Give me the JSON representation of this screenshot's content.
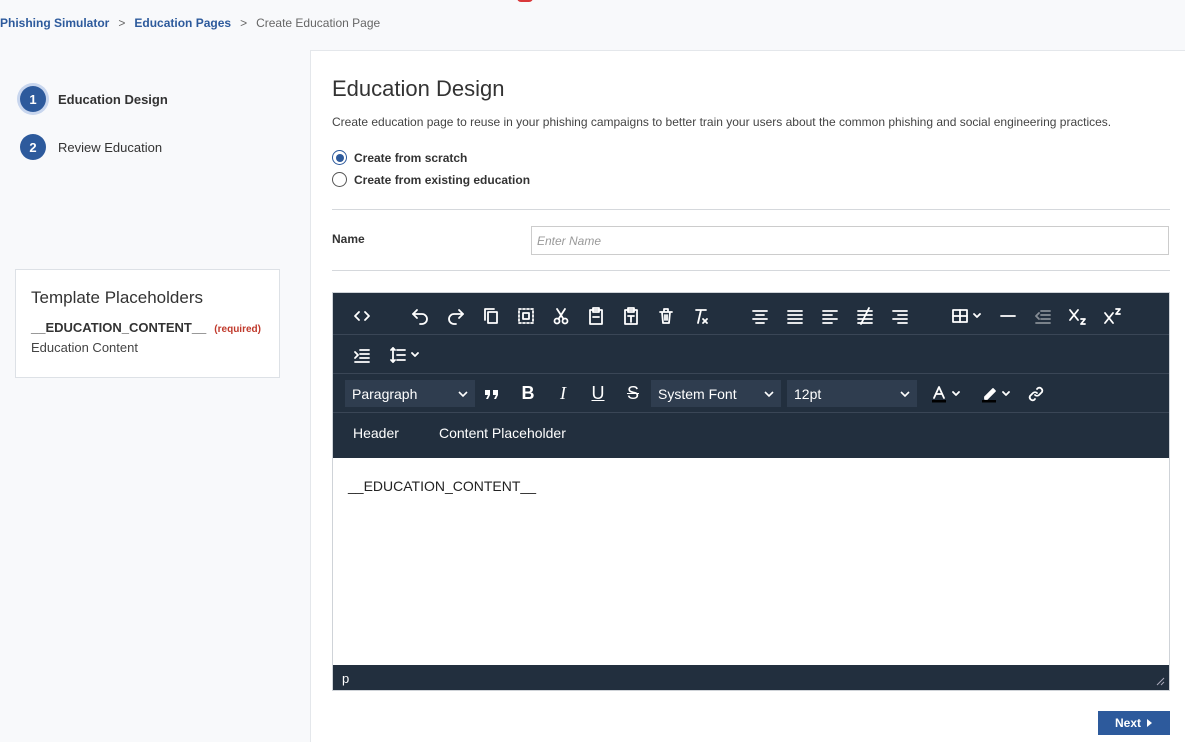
{
  "breadcrumb": {
    "item1": "Phishing Simulator",
    "item2": "Education Pages",
    "current": "Create Education Page",
    "separator": ">"
  },
  "steps": [
    {
      "number": "1",
      "label": "Education Design",
      "active": true
    },
    {
      "number": "2",
      "label": "Review Education",
      "active": false
    }
  ],
  "placeholders": {
    "title": "Template Placeholders",
    "key": "__EDUCATION_CONTENT__",
    "required": "(required)",
    "description": "Education Content"
  },
  "main": {
    "title": "Education Design",
    "description": "Create education page to reuse in your phishing campaigns to better train your users about the common phishing and social engineering practices.",
    "radio_scratch": "Create from scratch",
    "radio_existing": "Create from existing education",
    "selected_option": "Create from scratch",
    "name_label": "Name",
    "name_placeholder": "Enter Name",
    "name_value": ""
  },
  "editor": {
    "block_format": "Paragraph",
    "font_family": "System Font",
    "font_size": "12pt",
    "menu_header": "Header",
    "menu_content_placeholder": "Content Placeholder",
    "content": "__EDUCATION_CONTENT__",
    "status_path": "p",
    "toolbar_icons": [
      "source-code",
      "undo",
      "redo",
      "copy",
      "select-all",
      "cut",
      "paste",
      "paste-text",
      "delete",
      "remove-format",
      "align-center",
      "justify",
      "align-left",
      "strikethrough-lines",
      "align-right",
      "table",
      "horizontal-line",
      "outdent",
      "subscript",
      "superscript",
      "indent",
      "line-height",
      "blockquote",
      "bold",
      "italic",
      "underline",
      "strikethrough",
      "text-color",
      "highlight-color",
      "link"
    ]
  },
  "buttons": {
    "next": "Next"
  },
  "colors": {
    "primary": "#2d5a9c",
    "toolbar": "#222f3e",
    "required": "#c0392b"
  }
}
